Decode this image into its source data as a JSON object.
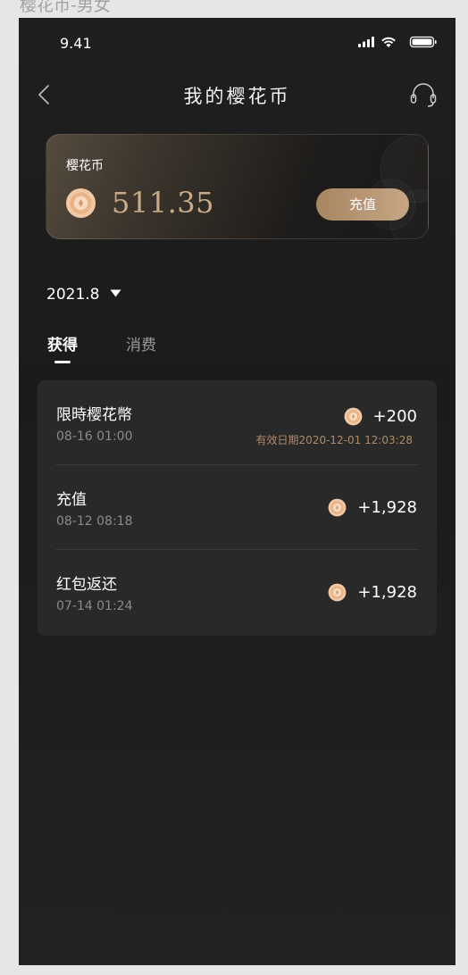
{
  "artboard_label": "樱花币-男女",
  "status_bar": {
    "time": "9.41",
    "icons": [
      "cellular-signal-icon",
      "wifi-icon",
      "battery-icon"
    ]
  },
  "header": {
    "title": "我的樱花币",
    "back_icon": "chevron-left-icon",
    "support_icon": "headset-icon"
  },
  "balance_card": {
    "label": "樱花币",
    "balance": "511.35",
    "recharge_label": "充值",
    "coin_icon": "sakura-coin-icon"
  },
  "filter": {
    "month": "2021.8",
    "caret_icon": "caret-down-icon"
  },
  "tabs": [
    {
      "label": "获得",
      "active": true
    },
    {
      "label": "消费",
      "active": false
    }
  ],
  "records": [
    {
      "title": "限時樱花幣",
      "time": "08-16 01:00",
      "amount": "+200",
      "expiry": "有效日期2020-12-01 12:03:28"
    },
    {
      "title": "充值",
      "time": "08-12 08:18",
      "amount": "+1,928"
    },
    {
      "title": "红包返还",
      "time": "07-14 01:24",
      "amount": "+1,928"
    }
  ],
  "colors": {
    "background": "#1f1f1f",
    "card_surface": "#292929",
    "accent_gold": "#c9ab8a",
    "button_gold": "#b8946f",
    "expiry_text": "#b08a66",
    "muted_text": "#8a8a8a"
  }
}
